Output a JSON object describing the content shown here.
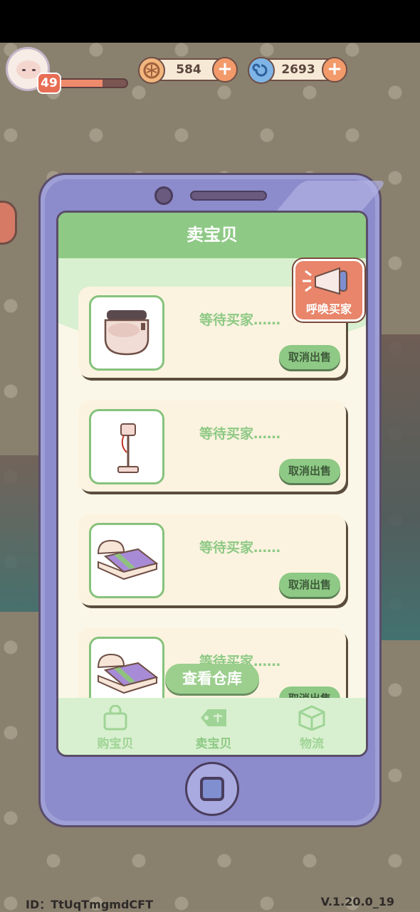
{
  "hud": {
    "level": "49",
    "level_progress": 0.65,
    "coins": "584",
    "gems": "2693"
  },
  "screen": {
    "title": "卖宝贝",
    "summon_label": "呼唤买家",
    "items": [
      {
        "item_icon": "smart-toilet-icon",
        "status": "等待买家……",
        "cancel_label": "取消出售"
      },
      {
        "item_icon": "floor-lamp-icon",
        "status": "等待买家……",
        "cancel_label": "取消出售"
      },
      {
        "item_icon": "purple-bed-icon",
        "status": "等待买家……",
        "cancel_label": "取消出售"
      },
      {
        "item_icon": "purple-bed-icon",
        "status": "等待买家……",
        "cancel_label": "取消出售"
      }
    ],
    "view_storage": "查看仓库",
    "nav": {
      "buy": "购宝贝",
      "sell": "卖宝贝",
      "logistics": "物流"
    }
  },
  "footer": {
    "id": "ID：TtUqTmgmdCFT",
    "version": "V.1.20.0_19"
  },
  "colors": {
    "accent_green": "#8ec985",
    "phone_purple": "#9e9fd6",
    "plus_orange": "#f39a6a"
  }
}
